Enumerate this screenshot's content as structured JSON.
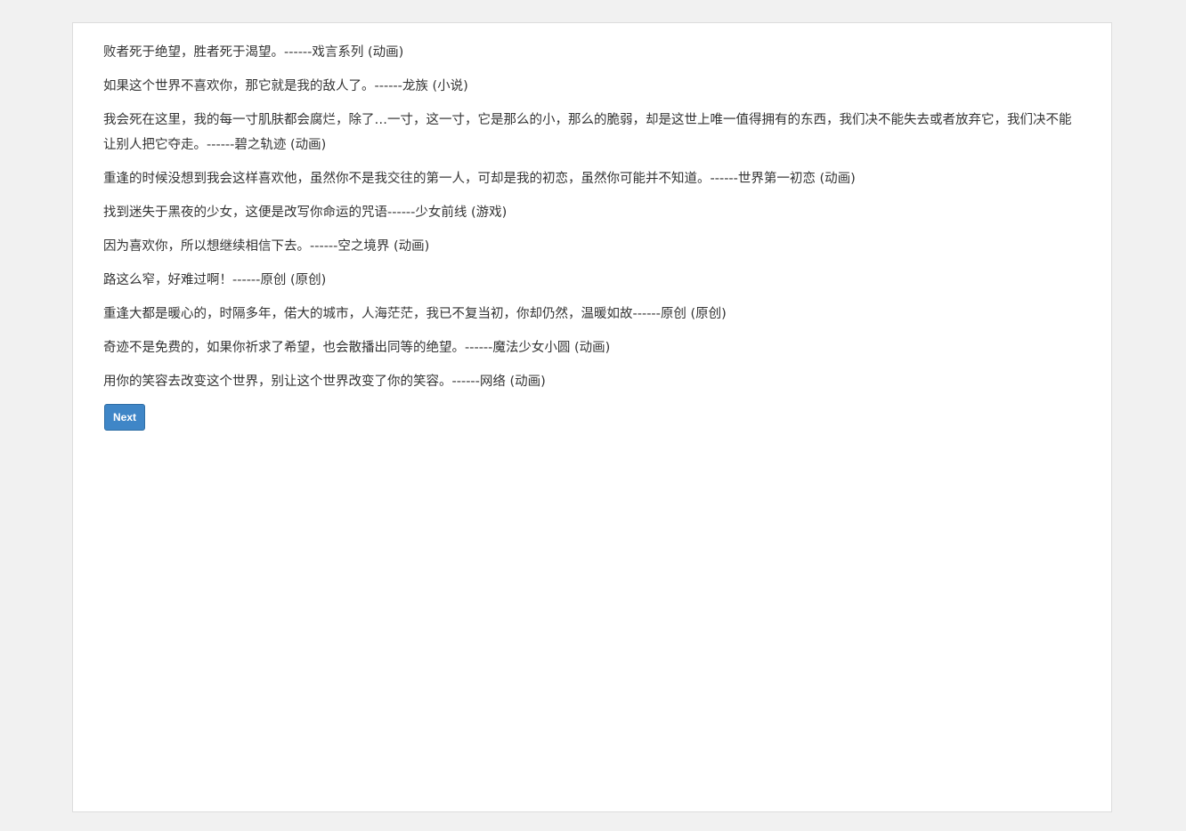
{
  "quotes": [
    "败者死于绝望，胜者死于渴望。------戏言系列 (动画)",
    "如果这个世界不喜欢你，那它就是我的敌人了。------龙族 (小说)",
    "我会死在这里，我的每一寸肌肤都会腐烂，除了…一寸，这一寸，它是那么的小，那么的脆弱，却是这世上唯一值得拥有的东西，我们决不能失去或者放弃它，我们决不能让别人把它夺走。------碧之轨迹 (动画)",
    "重逢的时候没想到我会这样喜欢他，虽然你不是我交往的第一人，可却是我的初恋，虽然你可能并不知道。------世界第一初恋 (动画)",
    "找到迷失于黑夜的少女，这便是改写你命运的咒语------少女前线 (游戏)",
    "因为喜欢你，所以想继续相信下去。------空之境界 (动画)",
    "路这么窄，好难过啊！------原创 (原创)",
    "重逢大都是暖心的，时隔多年，偌大的城市，人海茫茫，我已不复当初，你却仍然，温暖如故------原创 (原创)",
    "奇迹不是免费的，如果你祈求了希望，也会散播出同等的绝望。------魔法少女小圆 (动画)",
    "用你的笑容去改变这个世界，别让这个世界改变了你的笑容。------网络 (动画)"
  ],
  "next_label": "Next"
}
